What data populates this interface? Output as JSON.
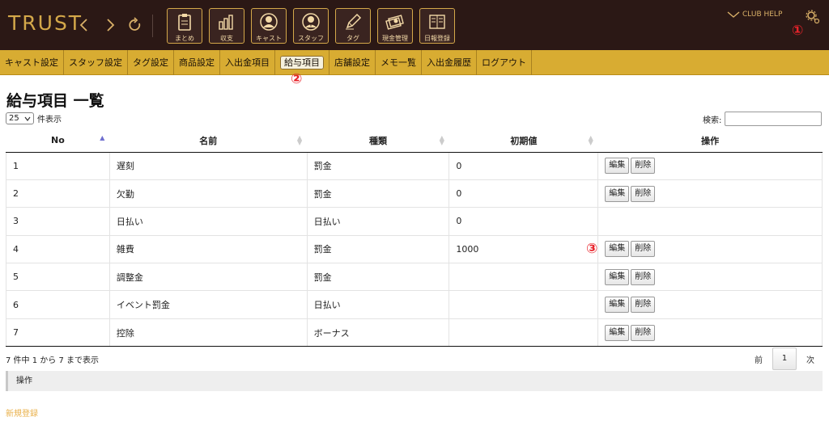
{
  "header": {
    "logo": "TRUST",
    "tiles": [
      {
        "label": "まとめ",
        "icon": "clipboard-icon"
      },
      {
        "label": "収支",
        "icon": "bar-chart-icon"
      },
      {
        "label": "キャスト",
        "icon": "cast-person-icon"
      },
      {
        "label": "スタッフ",
        "icon": "staff-person-icon"
      },
      {
        "label": "タグ",
        "icon": "pencil-icon"
      },
      {
        "label": "現金管理",
        "icon": "cash-icon"
      },
      {
        "label": "日報登録",
        "icon": "book-icon"
      }
    ],
    "club_help": "CLUB HELP"
  },
  "markers": {
    "m1": "①",
    "m2": "②",
    "m3": "③"
  },
  "menu": [
    {
      "label": "キャスト設定"
    },
    {
      "label": "スタッフ設定"
    },
    {
      "label": "タグ設定"
    },
    {
      "label": "商品設定"
    },
    {
      "label": "入出金項目"
    },
    {
      "label": "給与項目",
      "active": true
    },
    {
      "label": "店舗設定"
    },
    {
      "label": "メモ一覧"
    },
    {
      "label": "入出金履歴"
    },
    {
      "label": "ログアウト"
    }
  ],
  "page": {
    "title": "給与項目 一覧",
    "length_value": "25",
    "length_suffix": "件表示",
    "search_label": "検索:",
    "search_value": ""
  },
  "table": {
    "columns": [
      "No",
      "名前",
      "種類",
      "初期値",
      "操作"
    ],
    "edit_label": "編集",
    "delete_label": "削除",
    "rows": [
      {
        "no": "1",
        "name": "遅刻",
        "type": "罰金",
        "initial": "0",
        "actions": true
      },
      {
        "no": "2",
        "name": "欠勤",
        "type": "罰金",
        "initial": "0",
        "actions": true
      },
      {
        "no": "3",
        "name": "日払い",
        "type": "日払い",
        "initial": "0",
        "actions": false
      },
      {
        "no": "4",
        "name": "雑費",
        "type": "罰金",
        "initial": "1000",
        "actions": true
      },
      {
        "no": "5",
        "name": "調整金",
        "type": "罰金",
        "initial": "",
        "actions": true
      },
      {
        "no": "6",
        "name": "イベント罰金",
        "type": "日払い",
        "initial": "",
        "actions": true
      },
      {
        "no": "7",
        "name": "控除",
        "type": "ボーナス",
        "initial": "",
        "actions": true
      }
    ]
  },
  "footer": {
    "info": "7 件中 1 から 7 まで表示",
    "prev": "前",
    "current": "1",
    "next": "次",
    "ops_label": "操作",
    "new_link": "新規登録"
  },
  "colors": {
    "header_bg": "#2b1815",
    "menu_bg": "#d8ac32",
    "accent": "#d4a84a",
    "marker": "#e8232a",
    "link": "#e9b04a"
  }
}
